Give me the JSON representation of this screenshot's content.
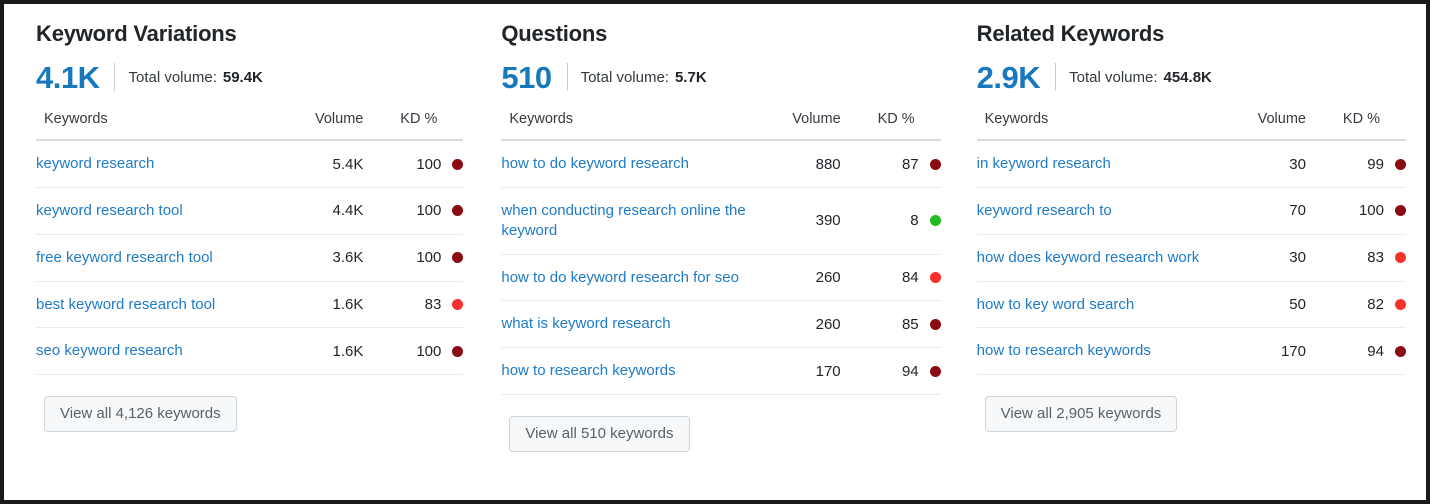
{
  "colors": {
    "accent_blue": "#1878bd",
    "link_blue": "#1e7bc8",
    "kd_dark_red": "#8b0b14",
    "kd_bright_red": "#f8312b",
    "kd_green": "#22bb22",
    "text_dark": "#212529",
    "frame": "#1a1a1a"
  },
  "table_headers": {
    "keywords": "Keywords",
    "volume": "Volume",
    "kd": "KD %"
  },
  "total_volume_label": "Total volume:",
  "columns": [
    {
      "title": "Keyword Variations",
      "count": "4.1K",
      "total_volume": "59.4K",
      "view_all_label": "View all 4,126 keywords",
      "rows": [
        {
          "keyword": "keyword research",
          "volume": "5.4K",
          "kd": "100",
          "kd_color": "#8b0b14"
        },
        {
          "keyword": "keyword research tool",
          "volume": "4.4K",
          "kd": "100",
          "kd_color": "#8b0b14"
        },
        {
          "keyword": "free keyword research tool",
          "volume": "3.6K",
          "kd": "100",
          "kd_color": "#8b0b14"
        },
        {
          "keyword": "best keyword research tool",
          "volume": "1.6K",
          "kd": "83",
          "kd_color": "#f8312b"
        },
        {
          "keyword": "seo keyword research",
          "volume": "1.6K",
          "kd": "100",
          "kd_color": "#8b0b14"
        }
      ]
    },
    {
      "title": "Questions",
      "count": "510",
      "total_volume": "5.7K",
      "view_all_label": "View all 510 keywords",
      "rows": [
        {
          "keyword": "how to do keyword research",
          "volume": "880",
          "kd": "87",
          "kd_color": "#8b0b14"
        },
        {
          "keyword": "when conducting research online the keyword",
          "volume": "390",
          "kd": "8",
          "kd_color": "#22bb22"
        },
        {
          "keyword": "how to do keyword research for seo",
          "volume": "260",
          "kd": "84",
          "kd_color": "#f8312b"
        },
        {
          "keyword": "what is keyword research",
          "volume": "260",
          "kd": "85",
          "kd_color": "#8b0b14"
        },
        {
          "keyword": "how to research keywords",
          "volume": "170",
          "kd": "94",
          "kd_color": "#8b0b14"
        }
      ]
    },
    {
      "title": "Related Keywords",
      "count": "2.9K",
      "total_volume": "454.8K",
      "view_all_label": "View all 2,905 keywords",
      "rows": [
        {
          "keyword": "in keyword research",
          "volume": "30",
          "kd": "99",
          "kd_color": "#8b0b14"
        },
        {
          "keyword": "keyword research to",
          "volume": "70",
          "kd": "100",
          "kd_color": "#8b0b14"
        },
        {
          "keyword": "how does keyword research work",
          "volume": "30",
          "kd": "83",
          "kd_color": "#f8312b"
        },
        {
          "keyword": "how to key word search",
          "volume": "50",
          "kd": "82",
          "kd_color": "#f8312b"
        },
        {
          "keyword": "how to research keywords",
          "volume": "170",
          "kd": "94",
          "kd_color": "#8b0b14"
        }
      ]
    }
  ]
}
